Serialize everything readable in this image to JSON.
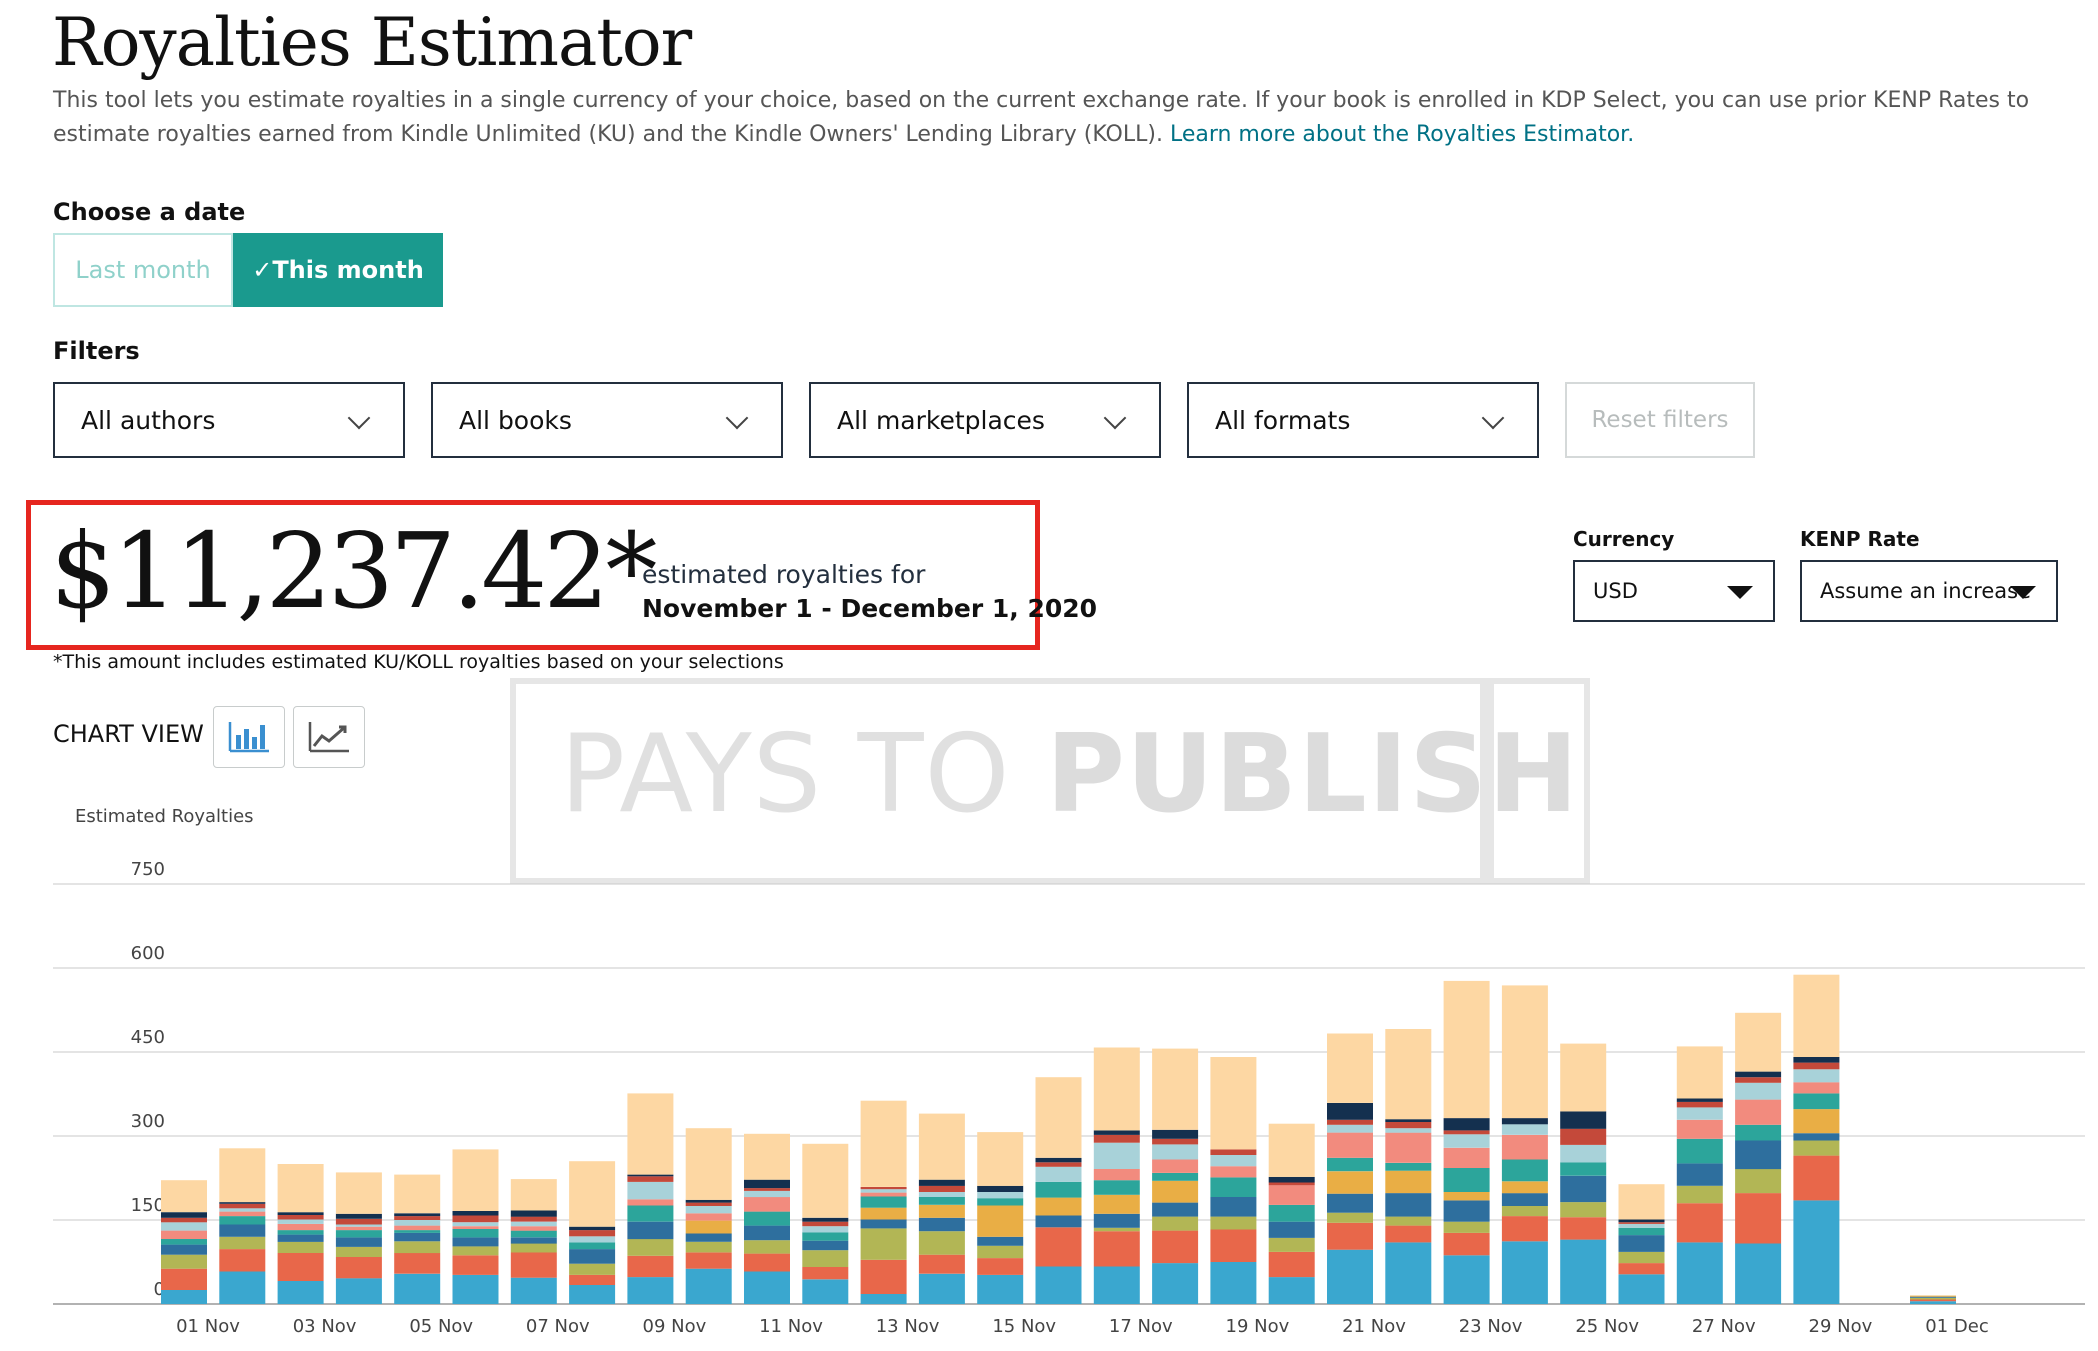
{
  "header": {
    "title": "Royalties Estimator",
    "description": "This tool lets you estimate royalties in a single currency of your choice, based on the current exchange rate. If your book is enrolled in KDP Select, you can use prior KENP Rates to estimate royalties earned from Kindle Unlimited (KU) and the Kindle Owners' Lending Library (KOLL).",
    "learn_more_link": "Learn more about the Royalties Estimator."
  },
  "date_picker": {
    "label": "Choose a date",
    "options": [
      {
        "label": "Last month",
        "selected": false
      },
      {
        "label": "✓This month",
        "selected": true
      }
    ]
  },
  "filters": {
    "label": "Filters",
    "dropdowns": [
      {
        "name": "authors",
        "value": "All authors"
      },
      {
        "name": "books",
        "value": "All books"
      },
      {
        "name": "marketplaces",
        "value": "All marketplaces"
      },
      {
        "name": "formats",
        "value": "All formats"
      }
    ],
    "reset_label": "Reset filters"
  },
  "summary": {
    "amount": "$11,237.42*",
    "caption": "estimated royalties for",
    "date_range": "November 1 - December 1, 2020",
    "footnote": "*This amount includes estimated KU/KOLL royalties based on your selections"
  },
  "currency": {
    "label": "Currency",
    "value": "USD"
  },
  "kenp_rate": {
    "label": "KENP Rate",
    "value": "Assume an increase"
  },
  "chart_view": {
    "label": "CHART VIEW",
    "buttons": [
      {
        "icon": "bar-chart-icon",
        "active": true
      },
      {
        "icon": "line-chart-icon",
        "active": false
      }
    ]
  },
  "watermark": {
    "text_light": "PAYS TO ",
    "text_bold": "PUBLISH"
  },
  "colors": {
    "accent": "#1a9a8e",
    "highlight_border": "#e6261f",
    "link": "#007185",
    "segments": [
      "#3aa7cf",
      "#e8674a",
      "#b2b655",
      "#2e6f9e",
      "#e9ae45",
      "#2ca59b",
      "#f28b7e",
      "#a8d2d9",
      "#c4493a",
      "#14304f",
      "#fdd7a3"
    ]
  },
  "chart_data": {
    "type": "bar",
    "stacked": true,
    "ylabel": "Estimated Royalties",
    "ylim": [
      0,
      750
    ],
    "yticks": [
      0,
      150,
      300,
      450,
      600,
      750
    ],
    "grid": true,
    "x_tick_labels": [
      "01 Nov",
      "03 Nov",
      "05 Nov",
      "07 Nov",
      "09 Nov",
      "11 Nov",
      "13 Nov",
      "15 Nov",
      "17 Nov",
      "19 Nov",
      "21 Nov",
      "23 Nov",
      "25 Nov",
      "27 Nov",
      "29 Nov",
      "01 Dec"
    ],
    "categories": [
      "01 Nov",
      "02 Nov",
      "03 Nov",
      "04 Nov",
      "05 Nov",
      "06 Nov",
      "07 Nov",
      "08 Nov",
      "09 Nov",
      "10 Nov",
      "11 Nov",
      "12 Nov",
      "13 Nov",
      "14 Nov",
      "15 Nov",
      "16 Nov",
      "17 Nov",
      "18 Nov",
      "19 Nov",
      "20 Nov",
      "21 Nov",
      "22 Nov",
      "23 Nov",
      "24 Nov",
      "25 Nov",
      "26 Nov",
      "27 Nov",
      "28 Nov",
      "29 Nov",
      "30 Nov",
      "01 Dec"
    ],
    "series": [
      {
        "values": [
          25,
          58,
          41,
          46,
          54,
          52,
          47,
          34,
          48,
          63,
          58,
          44,
          18,
          54,
          52,
          67,
          67,
          73,
          75,
          48,
          97,
          110,
          87,
          112,
          115,
          53,
          110,
          108,
          185,
          0,
          5
        ]
      },
      {
        "values": [
          38,
          40,
          50,
          38,
          37,
          35,
          45,
          18,
          38,
          29,
          32,
          22,
          61,
          34,
          30,
          70,
          63,
          58,
          58,
          45,
          48,
          30,
          40,
          45,
          40,
          20,
          70,
          90,
          80,
          0,
          3
        ]
      },
      {
        "values": [
          25,
          22,
          20,
          18,
          21,
          16,
          16,
          20,
          30,
          19,
          24,
          30,
          56,
          42,
          22,
          0,
          6,
          25,
          23,
          25,
          18,
          16,
          20,
          18,
          27,
          20,
          31,
          43,
          27,
          0,
          3
        ]
      },
      {
        "values": [
          18,
          22,
          13,
          17,
          15,
          16,
          11,
          26,
          31,
          15,
          26,
          17,
          16,
          24,
          16,
          21,
          25,
          25,
          35,
          29,
          34,
          42,
          38,
          23,
          47,
          30,
          40,
          51,
          13,
          0,
          2
        ]
      },
      {
        "values": [
          0,
          0,
          0,
          0,
          0,
          0,
          0,
          0,
          0,
          23,
          0,
          0,
          21,
          23,
          56,
          32,
          34,
          39,
          0,
          0,
          40,
          40,
          15,
          21,
          0,
          0,
          0,
          0,
          43,
          0,
          2
        ]
      },
      {
        "values": [
          10,
          15,
          8,
          13,
          5,
          15,
          12,
          12,
          29,
          0,
          25,
          15,
          20,
          14,
          13,
          28,
          26,
          14,
          35,
          30,
          24,
          14,
          43,
          39,
          24,
          13,
          44,
          28,
          28,
          0,
          0
        ]
      },
      {
        "values": [
          15,
          8,
          11,
          6,
          8,
          5,
          8,
          0,
          11,
          13,
          26,
          0,
          7,
          0,
          0,
          0,
          20,
          24,
          20,
          35,
          45,
          54,
          36,
          44,
          0,
          0,
          34,
          45,
          20,
          0,
          0
        ]
      },
      {
        "values": [
          15,
          6,
          8,
          4,
          10,
          7,
          8,
          11,
          31,
          13,
          11,
          11,
          6,
          9,
          11,
          27,
          47,
          27,
          20,
          0,
          14,
          8,
          24,
          19,
          31,
          7,
          22,
          30,
          23,
          0,
          0
        ]
      },
      {
        "values": [
          8,
          8,
          8,
          10,
          7,
          12,
          9,
          11,
          10,
          6,
          5,
          8,
          4,
          11,
          0,
          8,
          14,
          10,
          10,
          5,
          9,
          11,
          7,
          0,
          29,
          3,
          10,
          10,
          12,
          0,
          0
        ]
      },
      {
        "values": [
          10,
          3,
          5,
          9,
          5,
          8,
          11,
          6,
          3,
          5,
          15,
          7,
          0,
          11,
          11,
          8,
          8,
          16,
          0,
          10,
          30,
          5,
          22,
          11,
          31,
          5,
          6,
          10,
          10,
          0,
          0
        ]
      },
      {
        "values": [
          57,
          96,
          86,
          74,
          69,
          110,
          56,
          117,
          145,
          128,
          82,
          132,
          154,
          118,
          96,
          144,
          148,
          145,
          165,
          95,
          124,
          161,
          245,
          237,
          121,
          63,
          93,
          105,
          147,
          0,
          0
        ]
      }
    ]
  }
}
